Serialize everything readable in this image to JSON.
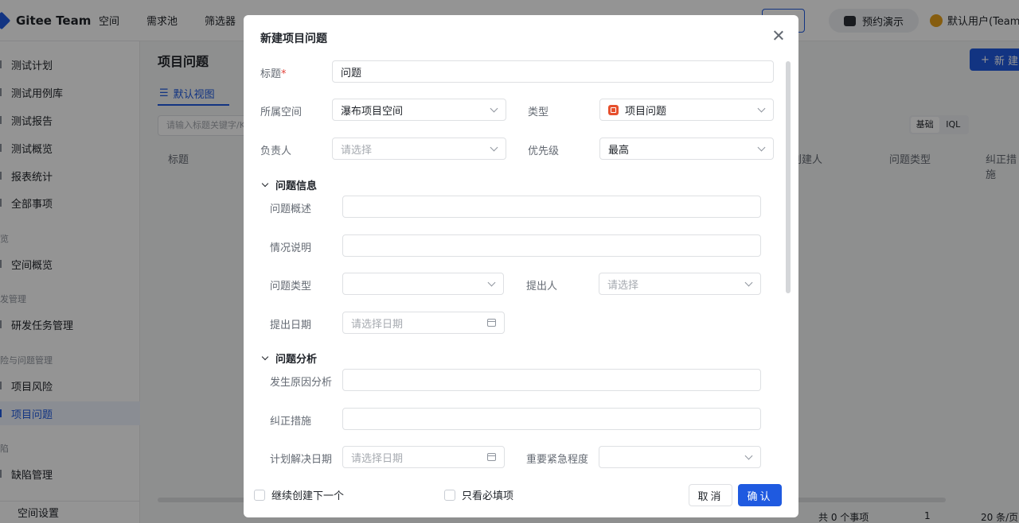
{
  "app": {
    "name": "Gitee Team"
  },
  "topnav": {
    "items": [
      "空间",
      "需求池",
      "筛选器"
    ],
    "demo_label": "预约演示",
    "user_label": "默认用户(TeamL"
  },
  "sidebar": {
    "items": [
      "测试计划",
      "测试用例库",
      "测试报告",
      "测试概览",
      "报表统计",
      "全部事项"
    ],
    "group_overview": "览",
    "overview_item": "空间概览",
    "group_dev": "发管理",
    "dev_item": "研发任务管理",
    "group_risk": "险与问题管理",
    "risk_item": "项目风险",
    "issue_item": "项目问题",
    "group_defect": "陷",
    "defect_item": "缺陷管理",
    "settings": "空间设置"
  },
  "page": {
    "title": "项目问题",
    "new_button": "新 建",
    "view_tab": "默认视图",
    "filter_placeholder": "请输入标题关键字/Ke",
    "seg_basic": "基础",
    "seg_iql": "IQL",
    "table_headers": {
      "title": "标题",
      "creator": "创建人",
      "issue_type": "问题类型",
      "corrective": "纠正措施"
    },
    "total": "共 0 个事项",
    "page_num": "1",
    "page_size": "20 条/页"
  },
  "modal": {
    "title": "新建项目问题",
    "title_label": "标题",
    "title_value": "问题",
    "space_label": "所属空间",
    "space_value": "瀑布项目空间",
    "type_label": "类型",
    "type_value": "项目问题",
    "assignee_label": "负责人",
    "assignee_placeholder": "请选择",
    "priority_label": "优先级",
    "priority_value": "最高",
    "section_info": "问题信息",
    "overview_label": "问题概述",
    "situation_label": "情况说明",
    "issue_type_label": "问题类型",
    "proposer_label": "提出人",
    "proposer_placeholder": "请选择",
    "propose_date_label": "提出日期",
    "date_placeholder": "请选择日期",
    "section_analysis": "问题分析",
    "cause_label": "发生原因分析",
    "corrective_label": "纠正措施",
    "plan_date_label": "计划解决日期",
    "urgency_label": "重要紧急程度",
    "continue_create": "继续创建下一个",
    "required_only": "只看必填项",
    "cancel": "取消",
    "confirm": "确认"
  }
}
